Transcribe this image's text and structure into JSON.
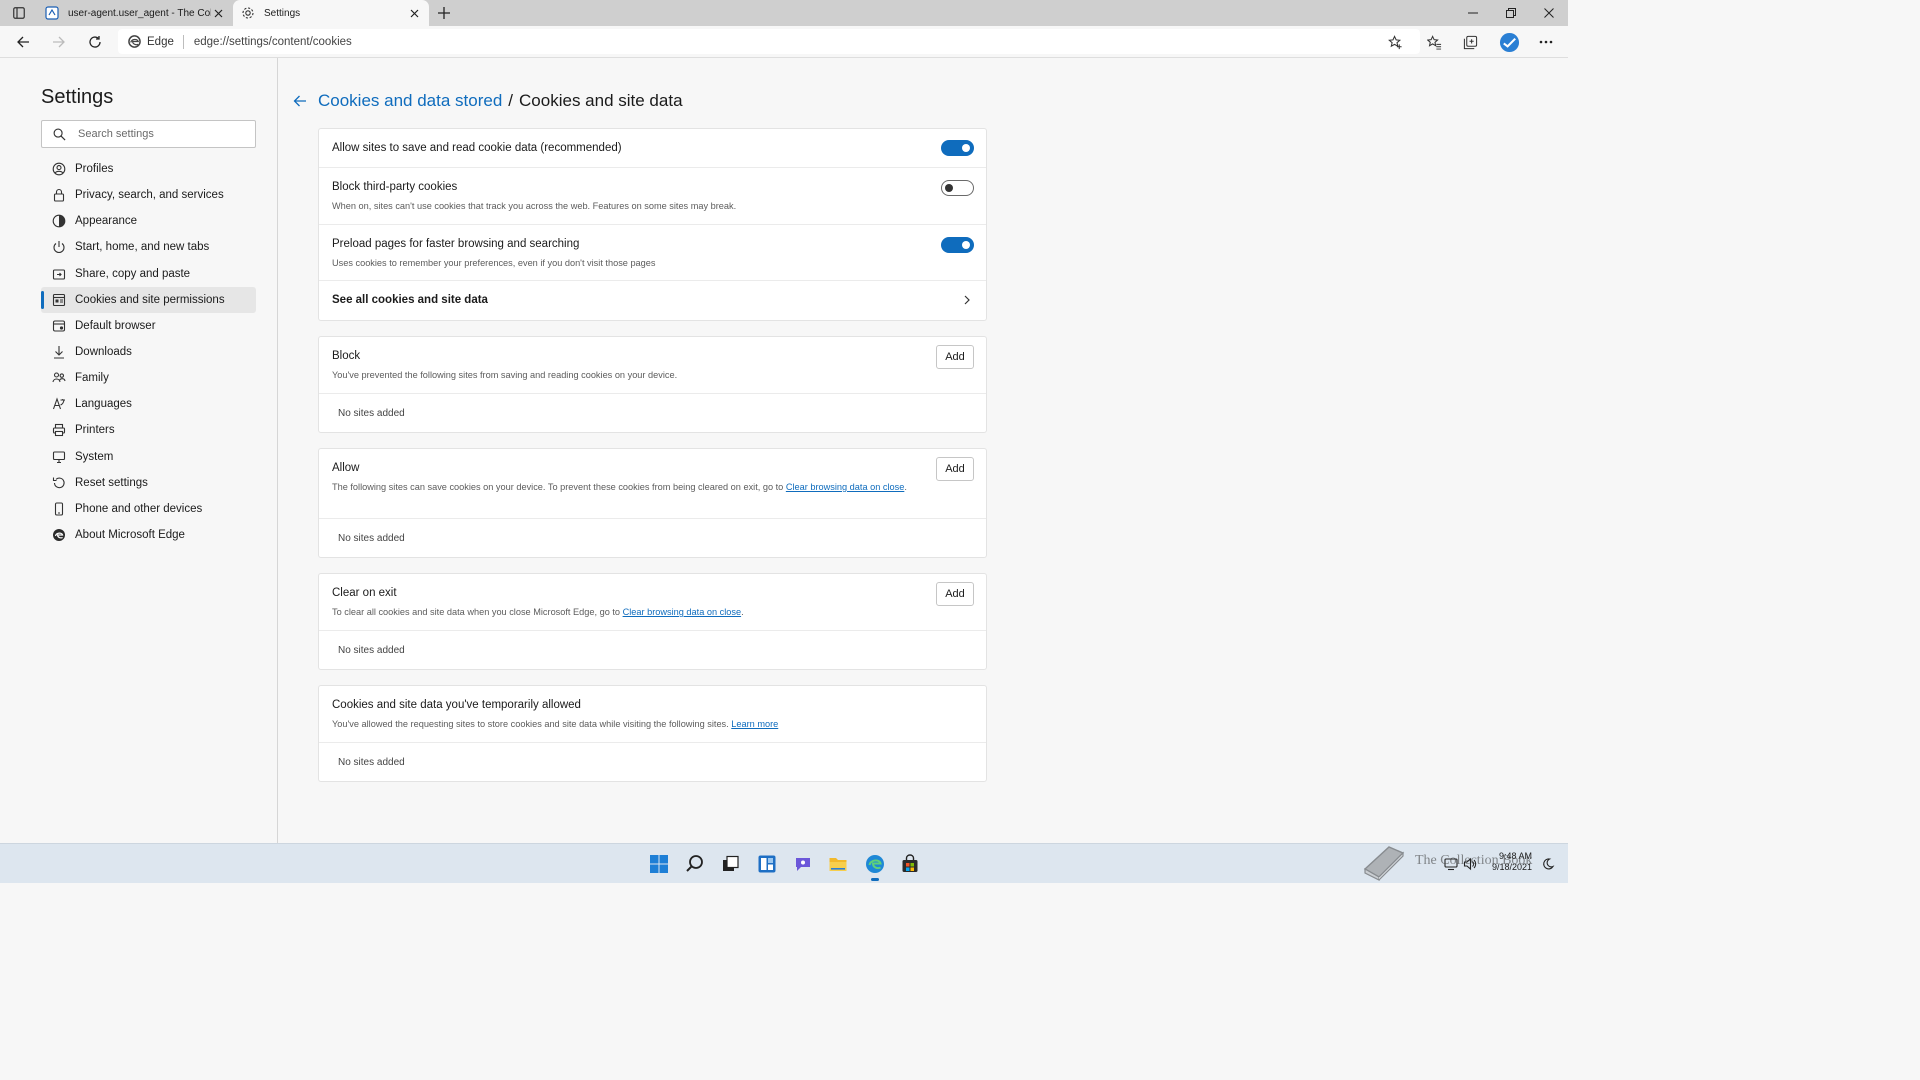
{
  "browser": {
    "tabs": [
      {
        "title": "user-agent.user_agent - The Coll",
        "icon": "document-icon"
      },
      {
        "title": "Settings",
        "icon": "gear-icon"
      }
    ],
    "address": {
      "badge": "Edge",
      "url": "edge://settings/content/cookies"
    }
  },
  "sidebar": {
    "title": "Settings",
    "search_placeholder": "Search settings",
    "items": [
      {
        "label": "Profiles",
        "icon": "profile-icon"
      },
      {
        "label": "Privacy, search, and services",
        "icon": "lock-icon"
      },
      {
        "label": "Appearance",
        "icon": "appearance-icon"
      },
      {
        "label": "Start, home, and new tabs",
        "icon": "power-icon"
      },
      {
        "label": "Share, copy and paste",
        "icon": "share-icon"
      },
      {
        "label": "Cookies and site permissions",
        "icon": "cookies-icon",
        "active": true
      },
      {
        "label": "Default browser",
        "icon": "browser-icon"
      },
      {
        "label": "Downloads",
        "icon": "download-icon"
      },
      {
        "label": "Family",
        "icon": "family-icon"
      },
      {
        "label": "Languages",
        "icon": "languages-icon"
      },
      {
        "label": "Printers",
        "icon": "printer-icon"
      },
      {
        "label": "System",
        "icon": "system-icon"
      },
      {
        "label": "Reset settings",
        "icon": "reset-icon"
      },
      {
        "label": "Phone and other devices",
        "icon": "phone-icon"
      },
      {
        "label": "About Microsoft Edge",
        "icon": "edge-icon"
      }
    ]
  },
  "main": {
    "breadcrumb": {
      "parent": "Cookies and data stored",
      "separator": "/",
      "current": "Cookies and site data"
    },
    "settings": [
      {
        "title": "Allow sites to save and read cookie data (recommended)",
        "on": true
      },
      {
        "title": "Block third-party cookies",
        "desc": "When on, sites can't use cookies that track you across the web. Features on some sites may break.",
        "on": false
      },
      {
        "title": "Preload pages for faster browsing and searching",
        "desc": "Uses cookies to remember your preferences, even if you don't visit those pages",
        "on": true
      },
      {
        "title": "See all cookies and site data"
      }
    ],
    "block": {
      "title": "Block",
      "desc": "You've prevented the following sites from saving and reading cookies on your device.",
      "add": "Add",
      "empty": "No sites added"
    },
    "allow": {
      "title": "Allow",
      "desc": "The following sites can save cookies on your device. To prevent these cookies from being cleared on exit, go to ",
      "link": "Clear browsing data on close",
      "desc_end": ".",
      "add": "Add",
      "empty": "No sites added"
    },
    "clear_on_exit": {
      "title": "Clear on exit",
      "desc": "To clear all cookies and site data when you close Microsoft Edge, go to ",
      "link": "Clear browsing data on close",
      "desc_end": ".",
      "add": "Add",
      "empty": "No sites added"
    },
    "temporary": {
      "title": "Cookies and site data you've temporarily allowed",
      "desc": "You've allowed the requesting sites to store cookies and site data while visiting the following sites. ",
      "link": "Learn more",
      "empty": "No sites added"
    }
  },
  "taskbar": {
    "apps": [
      "start-icon",
      "search-icon",
      "task-view-icon",
      "widgets-icon",
      "chat-icon",
      "file-explorer-icon",
      "edge-icon",
      "store-icon"
    ],
    "time": "9:48 AM",
    "date": "9/18/2021",
    "watermark": "The Collection Book"
  },
  "colors": {
    "accent": "#0f6cbd",
    "taskbar": "#dde6ef",
    "tabstrip": "#cfcfcf"
  }
}
